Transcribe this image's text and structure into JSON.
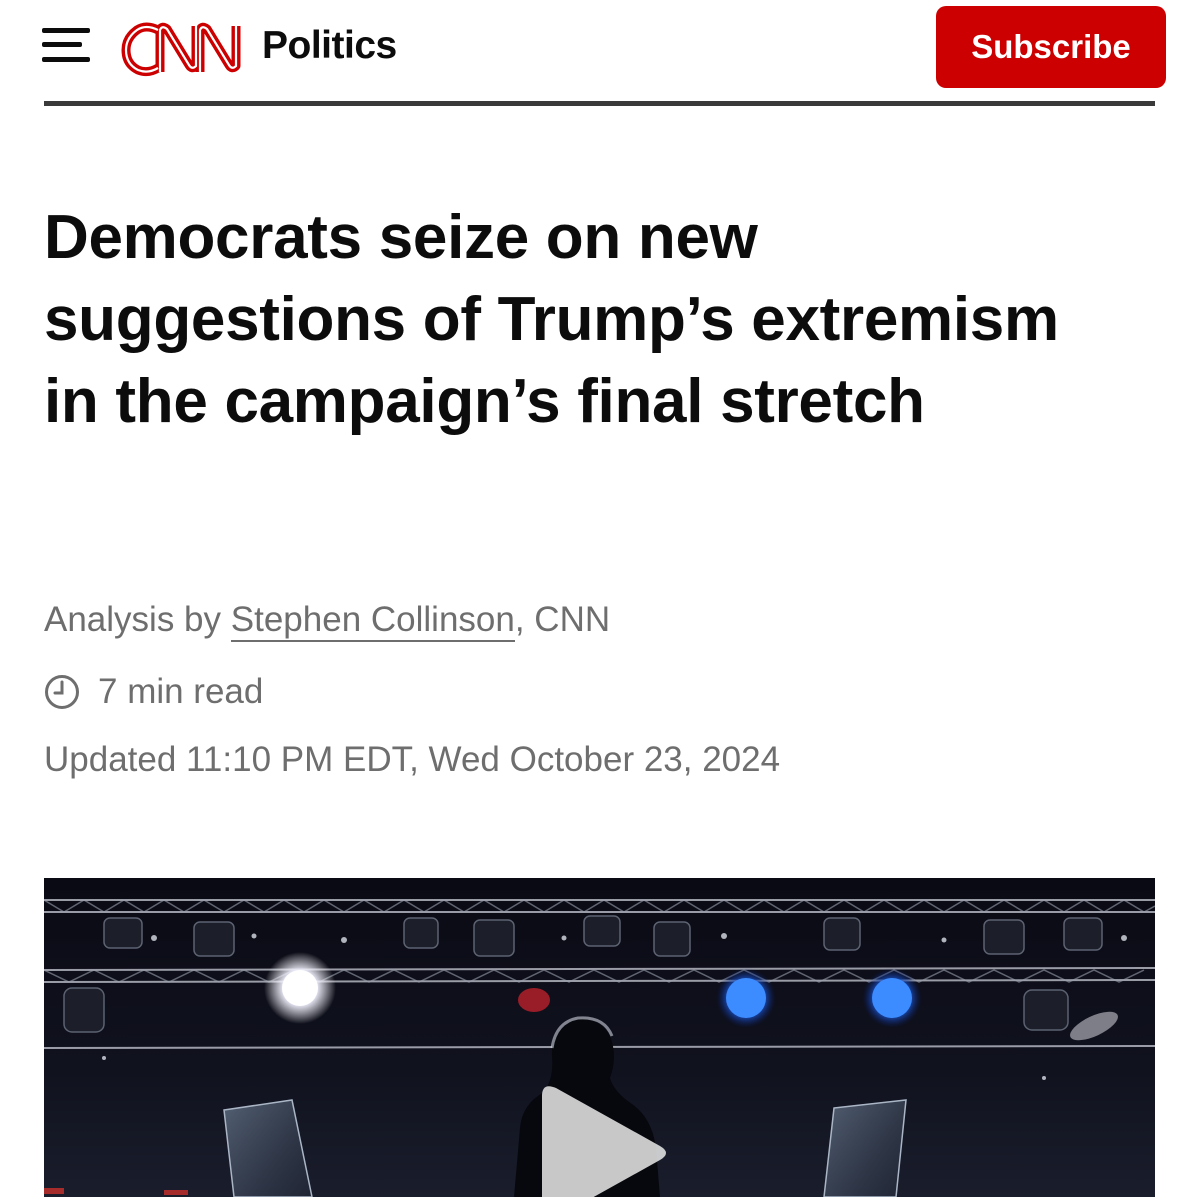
{
  "header": {
    "brand": "CNN",
    "section": "Politics",
    "subscribe_label": "Subscribe",
    "brand_color": "#cc0000"
  },
  "article": {
    "headline": "Democrats seize on new suggestions of Trump’s extremism in the campaign’s final stretch",
    "byline_prefix": "Analysis by",
    "author": "Stephen Collinson",
    "byline_suffix": ", CNN",
    "read_time": "7 min read",
    "updated": "Updated 11:10 PM EDT, Wed October 23, 2024"
  },
  "media": {
    "type": "video",
    "play_icon": "play-icon"
  },
  "icons": {
    "menu": "hamburger-menu-icon",
    "clock": "clock-icon"
  }
}
